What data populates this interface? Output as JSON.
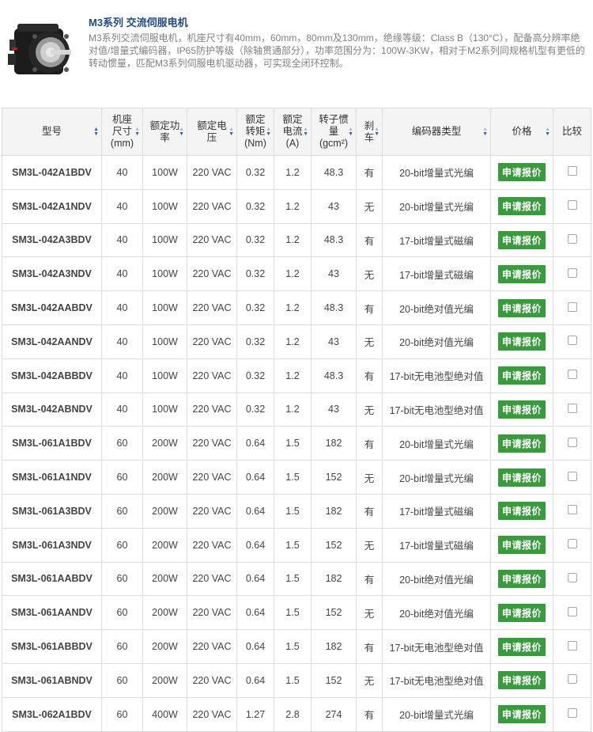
{
  "product": {
    "title": "M3系列 交流伺服电机",
    "description": "M3系列交流伺服电机，机座尺寸有40mm，60mm，80mm及130mm，绝缘等级：Class B（130°C），配备高分辨率绝对值/增量式编码器，IP65防护等级（除轴贯通部分），功率范围分为：100W-3KW，相对于M2系列同规格机型有更低的转动惯量，匹配M3系列伺服电机驱动器，可实现全闭环控制。"
  },
  "table": {
    "headers": [
      "型号",
      "机座尺寸(mm)",
      "额定功率",
      "额定电压",
      "额定转矩(Nm)",
      "额定电流(A)",
      "转子惯量(gcm²)",
      "刹车",
      "编码器类型",
      "价格",
      "比较"
    ],
    "header_lines": [
      [
        "型号"
      ],
      [
        "机座",
        "尺寸",
        "(mm)"
      ],
      [
        "额定功",
        "率"
      ],
      [
        "额定电",
        "压"
      ],
      [
        "额定",
        "转矩",
        "(Nm)"
      ],
      [
        "额定",
        "电流",
        "(A)"
      ],
      [
        "转子惯",
        "量",
        "(gcm²)"
      ],
      [
        "刹",
        "车"
      ],
      [
        "编码器类型"
      ],
      [
        "价格"
      ],
      [
        "比较"
      ]
    ],
    "quote_label": "申请报价",
    "rows": [
      [
        "SM3L-042A1BDV",
        "40",
        "100W",
        "220 VAC",
        "0.32",
        "1.2",
        "48.3",
        "有",
        "20-bit增量式光编"
      ],
      [
        "SM3L-042A1NDV",
        "40",
        "100W",
        "220 VAC",
        "0.32",
        "1.2",
        "43",
        "无",
        "20-bit增量式光编"
      ],
      [
        "SM3L-042A3BDV",
        "40",
        "100W",
        "220 VAC",
        "0.32",
        "1.2",
        "48.3",
        "有",
        "17-bit增量式磁编"
      ],
      [
        "SM3L-042A3NDV",
        "40",
        "100W",
        "220 VAC",
        "0.32",
        "1.2",
        "43",
        "无",
        "17-bit增量式磁编"
      ],
      [
        "SM3L-042AABDV",
        "40",
        "100W",
        "220 VAC",
        "0.32",
        "1.2",
        "48.3",
        "有",
        "20-bit绝对值光编"
      ],
      [
        "SM3L-042AANDV",
        "40",
        "100W",
        "220 VAC",
        "0.32",
        "1.2",
        "43",
        "无",
        "20-bit绝对值光编"
      ],
      [
        "SM3L-042ABBDV",
        "40",
        "100W",
        "220 VAC",
        "0.32",
        "1.2",
        "48.3",
        "有",
        "17-bit无电池型绝对值"
      ],
      [
        "SM3L-042ABNDV",
        "40",
        "100W",
        "220 VAC",
        "0.32",
        "1.2",
        "43",
        "无",
        "17-bit无电池型绝对值"
      ],
      [
        "SM3L-061A1BDV",
        "60",
        "200W",
        "220 VAC",
        "0.64",
        "1.5",
        "182",
        "有",
        "20-bit增量式光编"
      ],
      [
        "SM3L-061A1NDV",
        "60",
        "200W",
        "220 VAC",
        "0.64",
        "1.5",
        "152",
        "无",
        "20-bit增量式光编"
      ],
      [
        "SM3L-061A3BDV",
        "60",
        "200W",
        "220 VAC",
        "0.64",
        "1.5",
        "182",
        "有",
        "17-bit增量式磁编"
      ],
      [
        "SM3L-061A3NDV",
        "60",
        "200W",
        "220 VAC",
        "0.64",
        "1.5",
        "152",
        "无",
        "17-bit增量式磁编"
      ],
      [
        "SM3L-061AABDV",
        "60",
        "200W",
        "220 VAC",
        "0.64",
        "1.5",
        "182",
        "有",
        "20-bit绝对值光编"
      ],
      [
        "SM3L-061AANDV",
        "60",
        "200W",
        "220 VAC",
        "0.64",
        "1.5",
        "152",
        "无",
        "20-bit绝对值光编"
      ],
      [
        "SM3L-061ABBDV",
        "60",
        "200W",
        "220 VAC",
        "0.64",
        "1.5",
        "182",
        "有",
        "17-bit无电池型绝对值"
      ],
      [
        "SM3L-061ABNDV",
        "60",
        "200W",
        "220 VAC",
        "0.64",
        "1.5",
        "152",
        "无",
        "17-bit无电池型绝对值"
      ],
      [
        "SM3L-062A1BDV",
        "60",
        "400W",
        "220 VAC",
        "1.27",
        "2.8",
        "274",
        "有",
        "20-bit增量式光编"
      ]
    ]
  },
  "colors": {
    "model_link": "#174ea3",
    "quote_button": "#3a9b3e",
    "title": "#1f4a82"
  }
}
